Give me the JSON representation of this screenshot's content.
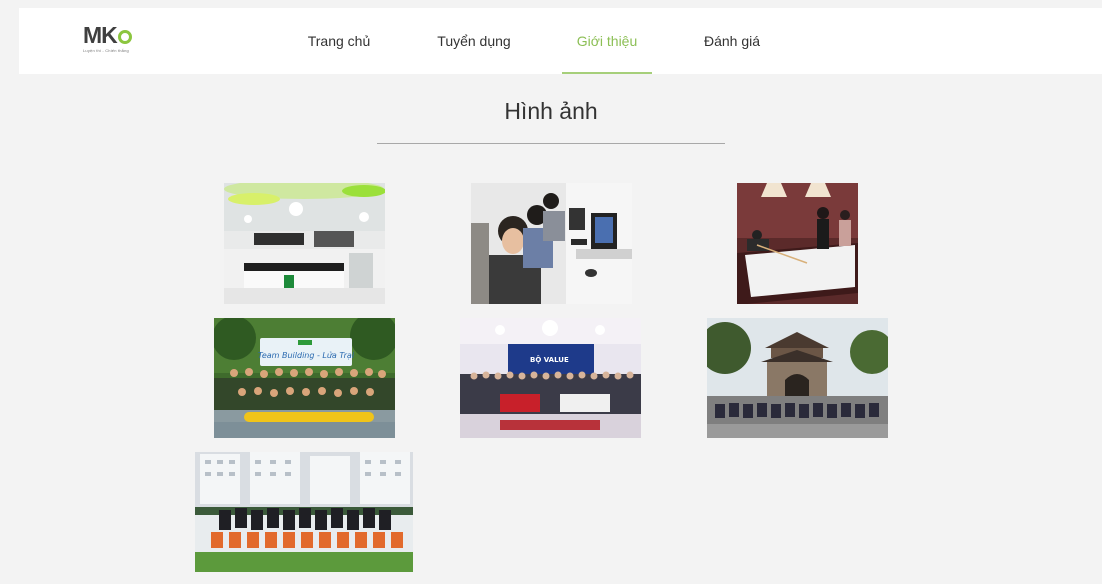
{
  "header": {
    "logo": {
      "mark": "MKO",
      "tagline": "Luyện thi - Chiến thắng"
    },
    "nav": [
      {
        "label": "Trang chủ",
        "active": false
      },
      {
        "label": "Tuyển dụng",
        "active": false
      },
      {
        "label": "Giới thiệu",
        "active": true
      },
      {
        "label": "Đánh giá",
        "active": false
      }
    ]
  },
  "gallery": {
    "title": "Hình ảnh",
    "photos": [
      {
        "name": "kitchen-photo"
      },
      {
        "name": "office-computers-photo"
      },
      {
        "name": "billiards-photo"
      },
      {
        "name": "team-building-photo",
        "banner": "Team Building - Lửa Trại"
      },
      {
        "name": "event-stage-photo",
        "banner": "BỘ VALUE"
      },
      {
        "name": "temple-trip-photo"
      },
      {
        "name": "football-team-photo"
      }
    ]
  },
  "colors": {
    "accent": "#8cbf55",
    "background": "#f3f3f3",
    "header": "#ffffff"
  }
}
